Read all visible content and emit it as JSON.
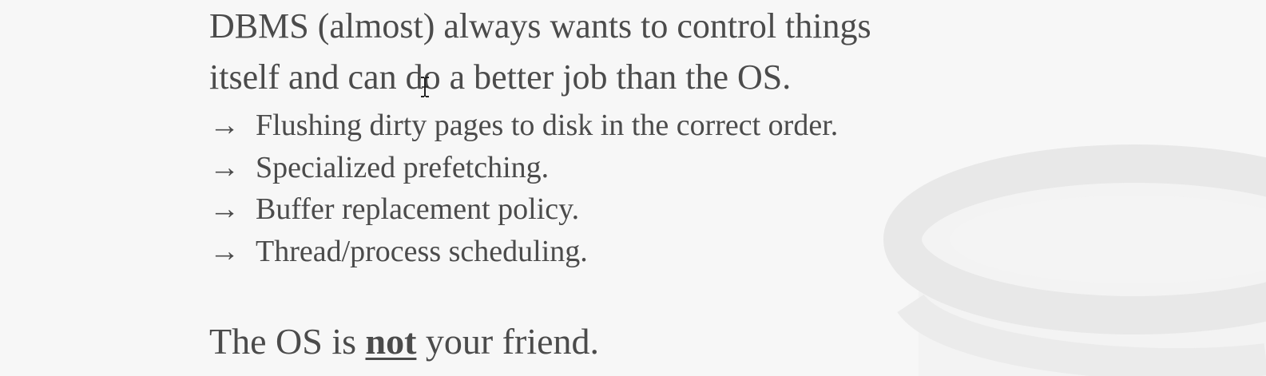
{
  "slide": {
    "headline_line1": "DBMS (almost) always wants to control things",
    "headline_line2": "itself and can do a better job than the OS.",
    "bullet_glyph": "→",
    "bullets": [
      "Flushing dirty pages to disk in the correct order.",
      "Specialized prefetching.",
      "Buffer replacement policy.",
      "Thread/process scheduling."
    ],
    "closing_before": "The OS is ",
    "closing_emphasis": "not",
    "closing_after": " your friend."
  },
  "decor": {
    "watermark_icon": "database-cylinder-icon",
    "cursor_icon": "text-cursor-icon",
    "text_color": "#4b4b4b",
    "background_color": "#f7f7f7"
  }
}
